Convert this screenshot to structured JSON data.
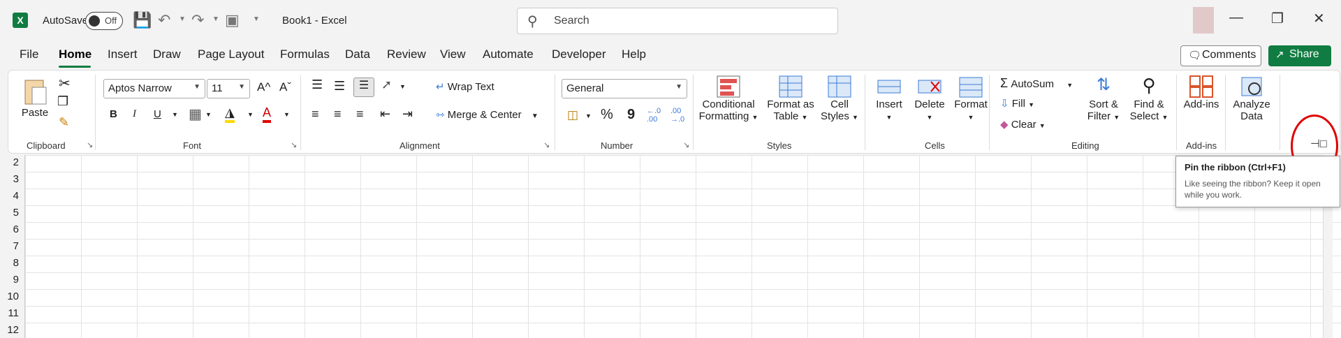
{
  "titlebar": {
    "autosave_label": "AutoSave",
    "autosave_state": "Off",
    "doc_title": "Book1  -  Excel",
    "search_placeholder": "Search",
    "logo_text": "X"
  },
  "menu": {
    "tabs": [
      "File",
      "Home",
      "Insert",
      "Draw",
      "Page Layout",
      "Formulas",
      "Data",
      "Review",
      "View",
      "Automate",
      "Developer",
      "Help"
    ],
    "active_tab": "Home",
    "comments_label": "Comments",
    "share_label": "Share"
  },
  "ribbon": {
    "clipboard": {
      "label": "Clipboard",
      "paste": "Paste"
    },
    "font": {
      "label": "Font",
      "font_name": "Aptos Narrow",
      "font_size": "11",
      "bold": "B",
      "italic": "I",
      "underline": "U",
      "grow": "A^",
      "shrink": "Aˇ",
      "font_color": "A"
    },
    "alignment": {
      "label": "Alignment",
      "wrap_text": "Wrap Text",
      "merge_center": "Merge & Center"
    },
    "number": {
      "label": "Number",
      "format": "General",
      "percent": "%",
      "comma": "9",
      "inc_decimal": "←.0\n.00",
      "dec_decimal": ".00\n→.0"
    },
    "styles": {
      "label": "Styles",
      "conditional_1": "Conditional",
      "conditional_2": "Formatting",
      "format_table_1": "Format as",
      "format_table_2": "Table",
      "cell_styles_1": "Cell",
      "cell_styles_2": "Styles"
    },
    "cells": {
      "label": "Cells",
      "insert": "Insert",
      "delete": "Delete",
      "format": "Format"
    },
    "editing": {
      "label": "Editing",
      "autosum": "AutoSum",
      "fill": "Fill",
      "clear": "Clear",
      "sort_1": "Sort &",
      "sort_2": "Filter",
      "find_1": "Find &",
      "find_2": "Select"
    },
    "addins": {
      "label": "Add-ins",
      "addins_btn": "Add-ins",
      "analyze_1": "Analyze",
      "analyze_2": "Data"
    }
  },
  "grid": {
    "rows": [
      "2",
      "3",
      "4",
      "5",
      "6",
      "7",
      "8",
      "9",
      "10",
      "11",
      "12"
    ]
  },
  "tooltip": {
    "title": "Pin the ribbon (Ctrl+F1)",
    "body": "Like seeing the ribbon? Keep it open while you work."
  },
  "colors": {
    "accent": "#107c41",
    "highlight_circle": "#e00000"
  }
}
